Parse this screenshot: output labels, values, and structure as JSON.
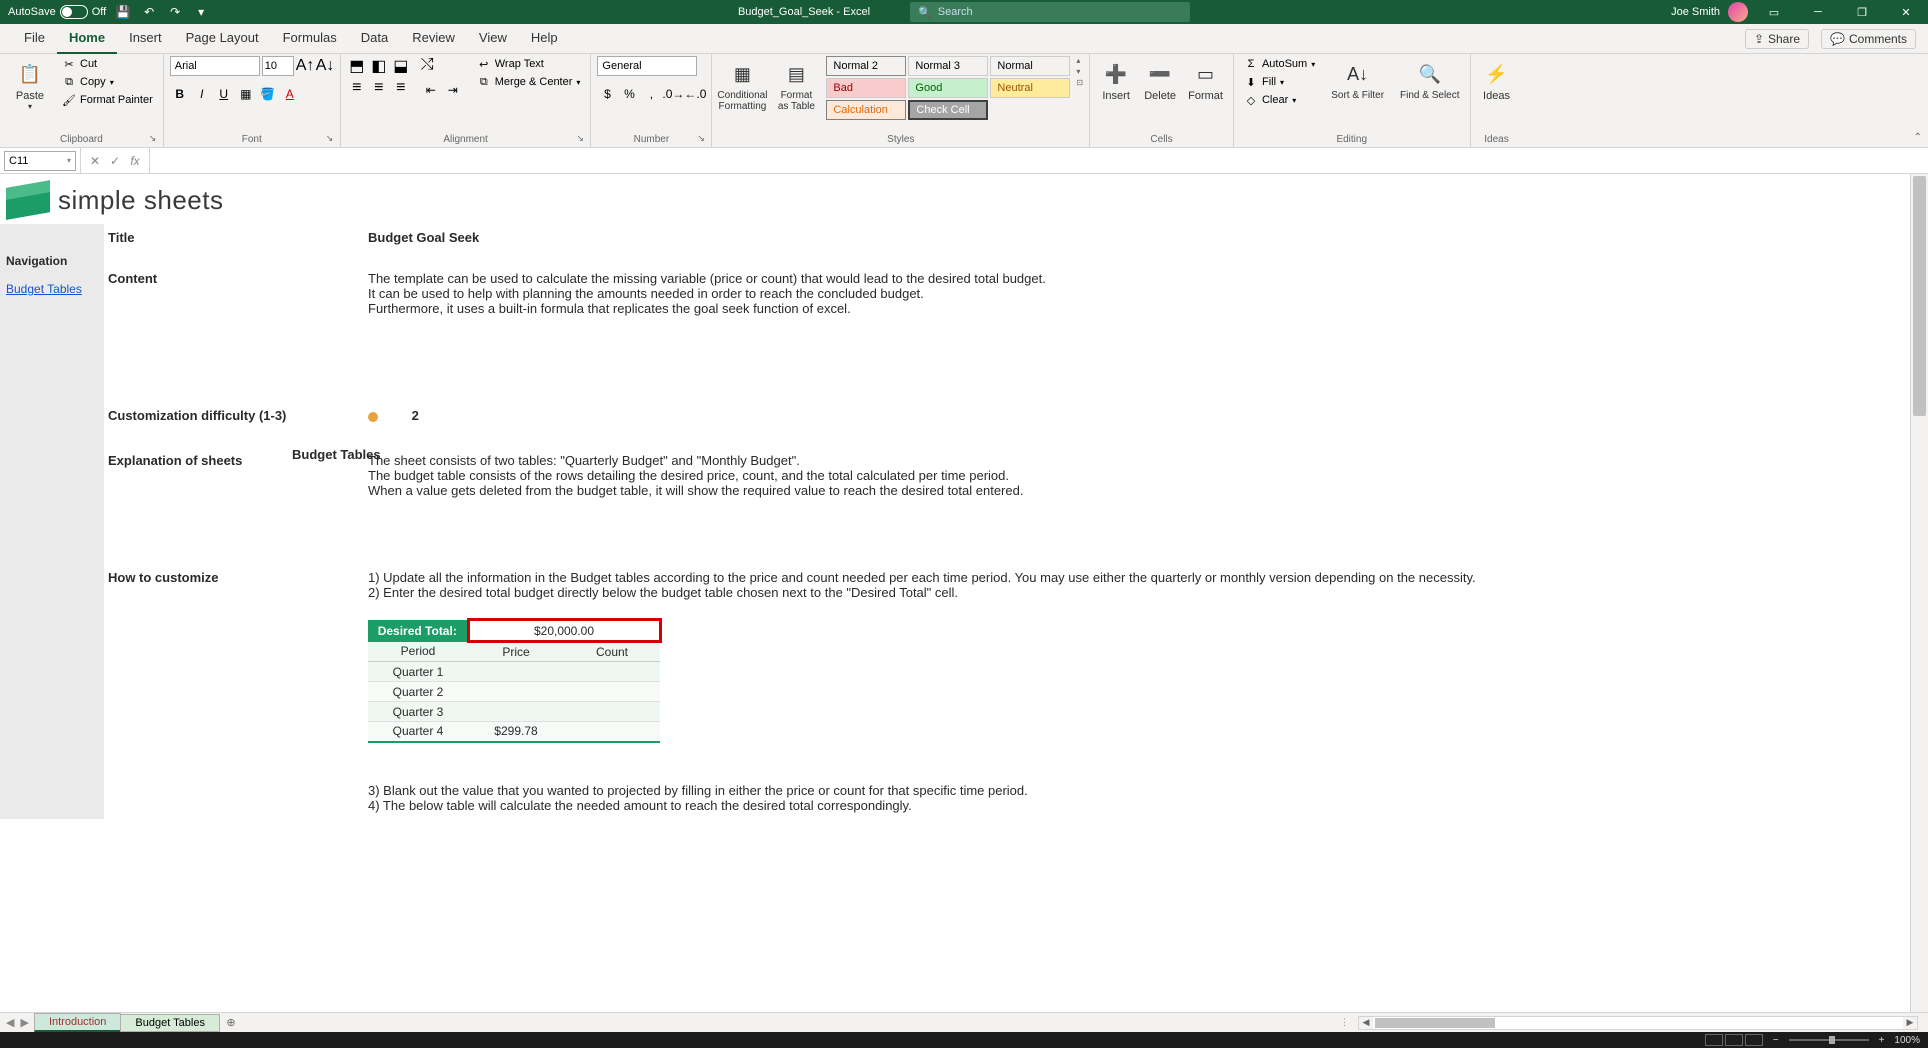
{
  "titlebar": {
    "autosave_label": "AutoSave",
    "autosave_state": "Off",
    "doc_title": "Budget_Goal_Seek - Excel",
    "search_placeholder": "Search",
    "user_name": "Joe Smith"
  },
  "ribbon_tabs": [
    "File",
    "Home",
    "Insert",
    "Page Layout",
    "Formulas",
    "Data",
    "Review",
    "View",
    "Help"
  ],
  "ribbon_active_tab": "Home",
  "share_label": "Share",
  "comments_label": "Comments",
  "ribbon": {
    "clipboard": {
      "label": "Clipboard",
      "paste": "Paste",
      "cut": "Cut",
      "copy": "Copy",
      "format_painter": "Format Painter"
    },
    "font": {
      "label": "Font",
      "name": "Arial",
      "size": "10"
    },
    "alignment": {
      "label": "Alignment",
      "wrap": "Wrap Text",
      "merge": "Merge & Center"
    },
    "number": {
      "label": "Number",
      "format": "General"
    },
    "styles": {
      "label": "Styles",
      "conditional": "Conditional Formatting",
      "format_table": "Format as Table",
      "cells": [
        "Normal 2",
        "Normal 3",
        "Normal",
        "Bad",
        "Good",
        "Neutral",
        "Calculation",
        "Check Cell"
      ]
    },
    "cells": {
      "label": "Cells",
      "insert": "Insert",
      "delete": "Delete",
      "format": "Format"
    },
    "editing": {
      "label": "Editing",
      "autosum": "AutoSum",
      "fill": "Fill",
      "clear": "Clear",
      "sort": "Sort & Filter",
      "find": "Find & Select"
    },
    "ideas": {
      "label": "Ideas",
      "button": "Ideas"
    }
  },
  "formula_bar": {
    "name_box": "C11",
    "formula": ""
  },
  "logo_text": "simple sheets",
  "nav": {
    "title": "Navigation",
    "link": "Budget Tables"
  },
  "doc": {
    "labels": {
      "title": "Title",
      "content": "Content",
      "custom_diff": "Customization difficulty (1-3)",
      "explain": "Explanation of sheets",
      "howto": "How to customize"
    },
    "title_value": "Budget Goal Seek",
    "content_lines": [
      "The template can be used to calculate the missing variable (price or count) that would lead to the desired total budget.",
      "It can be used to help with planning the amounts needed in order to reach the concluded budget.",
      "Furthermore, it uses a built-in formula that replicates the goal seek function of excel."
    ],
    "difficulty_value": "2",
    "explain_subhead": "Budget Tables",
    "explain_lines": [
      "The sheet consists of two tables: \"Quarterly Budget\" and \"Monthly Budget\".",
      "The budget table consists of the rows detailing the desired price, count, and the total calculated per time period.",
      "When a value gets deleted from the budget table, it will show the required value to reach the desired total entered."
    ],
    "howto_lines_top": [
      "1) Update all the information in the Budget tables according to the price and count needed per each time period. You may use either the quarterly or monthly version depending on the necessity.",
      "2) Enter the desired total budget directly below the budget table chosen next to the \"Desired Total\" cell."
    ],
    "howto_lines_bottom": [
      "3) Blank out the value that you wanted to projected by filling in either the price or count for that specific time period.",
      "4) The below table will calculate the needed amount to reach the desired total correspondingly."
    ],
    "table": {
      "desired_label": "Desired Total:",
      "desired_value": "$20,000.00",
      "headers": [
        "Period",
        "Price",
        "Count"
      ],
      "rows": [
        {
          "period": "Quarter 1",
          "price": "",
          "count": ""
        },
        {
          "period": "Quarter 2",
          "price": "",
          "count": ""
        },
        {
          "period": "Quarter 3",
          "price": "",
          "count": ""
        },
        {
          "period": "Quarter 4",
          "price": "$299.78",
          "count": ""
        }
      ]
    }
  },
  "sheet_tabs": {
    "active": "Introduction",
    "other": "Budget Tables"
  },
  "status": {
    "zoom": "100%"
  }
}
